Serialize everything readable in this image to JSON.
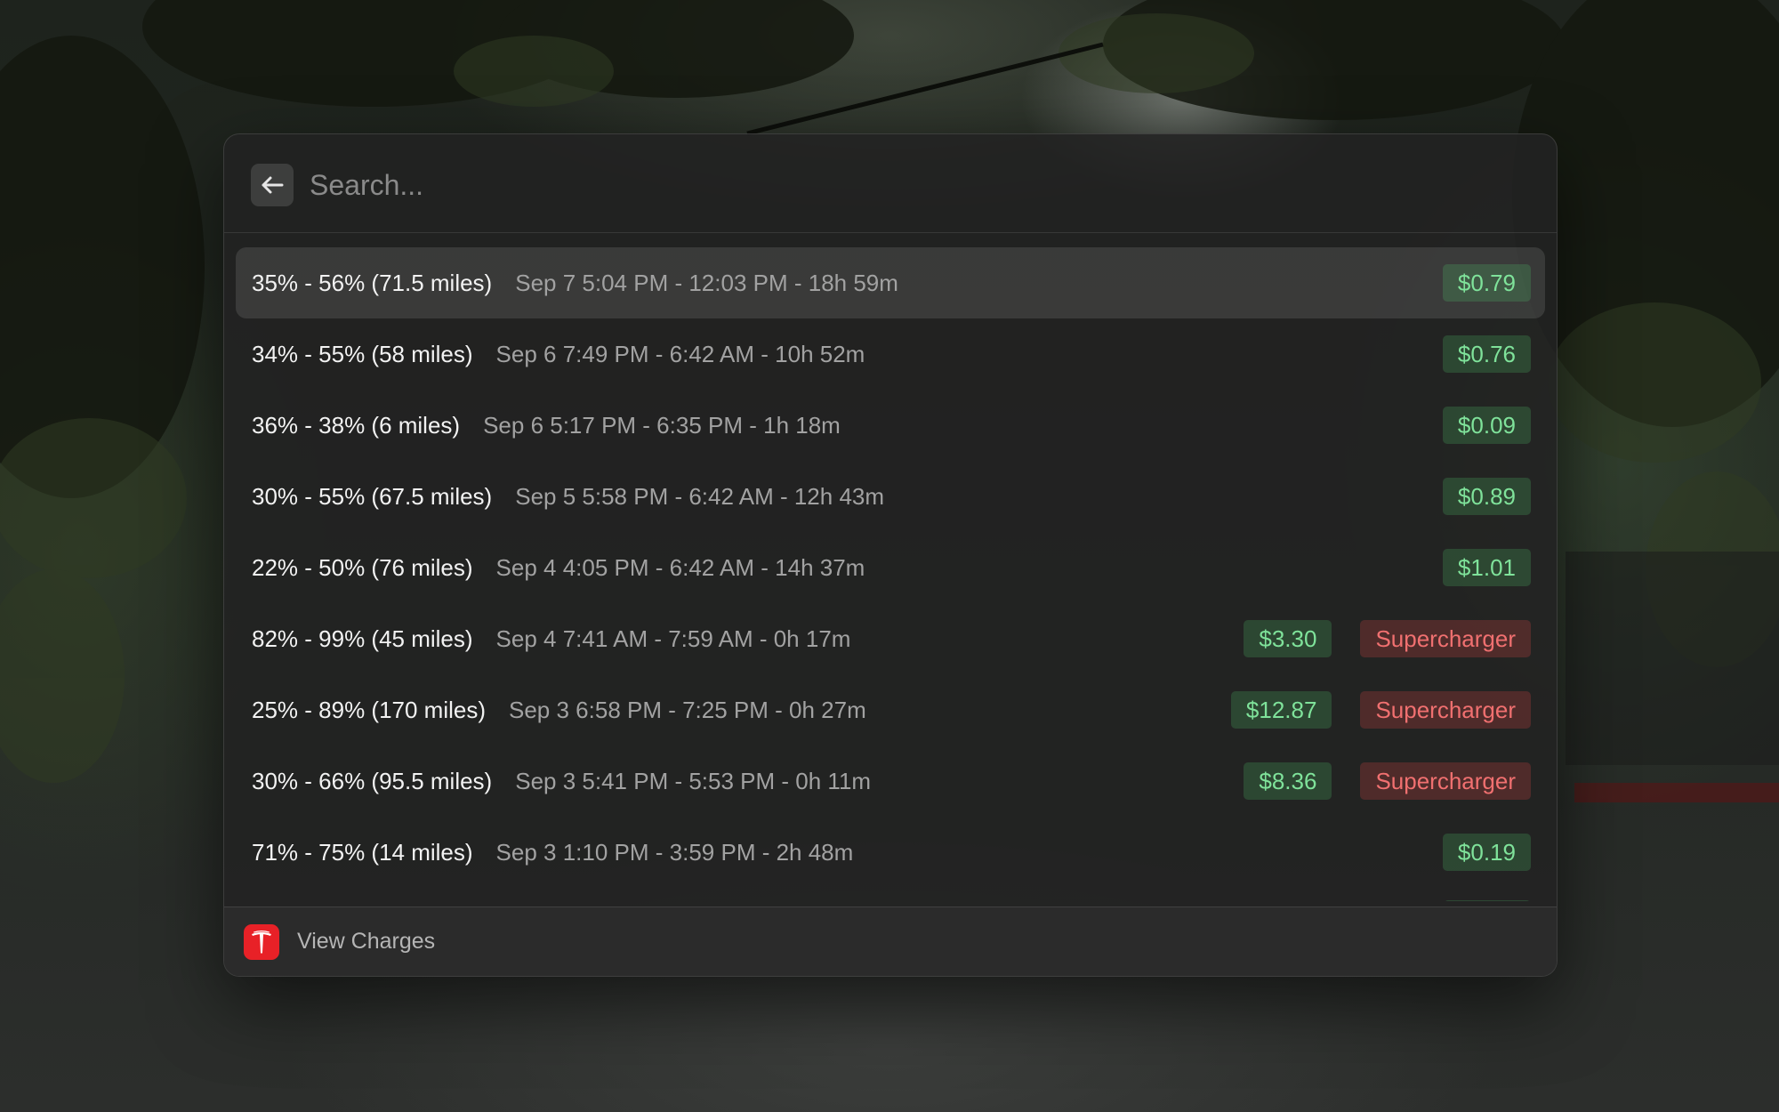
{
  "search": {
    "placeholder": "Search...",
    "value": ""
  },
  "navigation": {
    "back_icon": "arrow-left-icon"
  },
  "charges": [
    {
      "title": "35% - 56% (71.5 miles)",
      "subtitle": "Sep 7 5:04 PM - 12:03 PM - 18h 59m",
      "cost": "$0.79",
      "supercharger": ""
    },
    {
      "title": "34% - 55% (58 miles)",
      "subtitle": "Sep 6 7:49 PM - 6:42 AM - 10h 52m",
      "cost": "$0.76",
      "supercharger": ""
    },
    {
      "title": "36% - 38% (6 miles)",
      "subtitle": "Sep 6 5:17 PM - 6:35 PM - 1h 18m",
      "cost": "$0.09",
      "supercharger": ""
    },
    {
      "title": "30% - 55% (67.5 miles)",
      "subtitle": "Sep 5 5:58 PM - 6:42 AM - 12h 43m",
      "cost": "$0.89",
      "supercharger": ""
    },
    {
      "title": "22% - 50% (76 miles)",
      "subtitle": "Sep 4 4:05 PM - 6:42 AM - 14h 37m",
      "cost": "$1.01",
      "supercharger": ""
    },
    {
      "title": "82% - 99% (45 miles)",
      "subtitle": "Sep 4 7:41 AM - 7:59 AM - 0h 17m",
      "cost": "$3.30",
      "supercharger": "Supercharger"
    },
    {
      "title": "25% - 89% (170 miles)",
      "subtitle": "Sep 3 6:58 PM - 7:25 PM - 0h 27m",
      "cost": "$12.87",
      "supercharger": "Supercharger"
    },
    {
      "title": "30% - 66% (95.5 miles)",
      "subtitle": "Sep 3 5:41 PM - 5:53 PM - 0h 11m",
      "cost": "$8.36",
      "supercharger": "Supercharger"
    },
    {
      "title": "71% - 75% (14 miles)",
      "subtitle": "Sep 3 1:10 PM - 3:59 PM - 2h 48m",
      "cost": "$0.19",
      "supercharger": ""
    }
  ],
  "selected_index": 0,
  "footer": {
    "icon": "tesla-logo-icon",
    "title": "View Charges"
  },
  "colors": {
    "cost_tag_text": "#7fe29a",
    "supercharger_tag_text": "#f07070",
    "tesla_red": "#e82127"
  }
}
